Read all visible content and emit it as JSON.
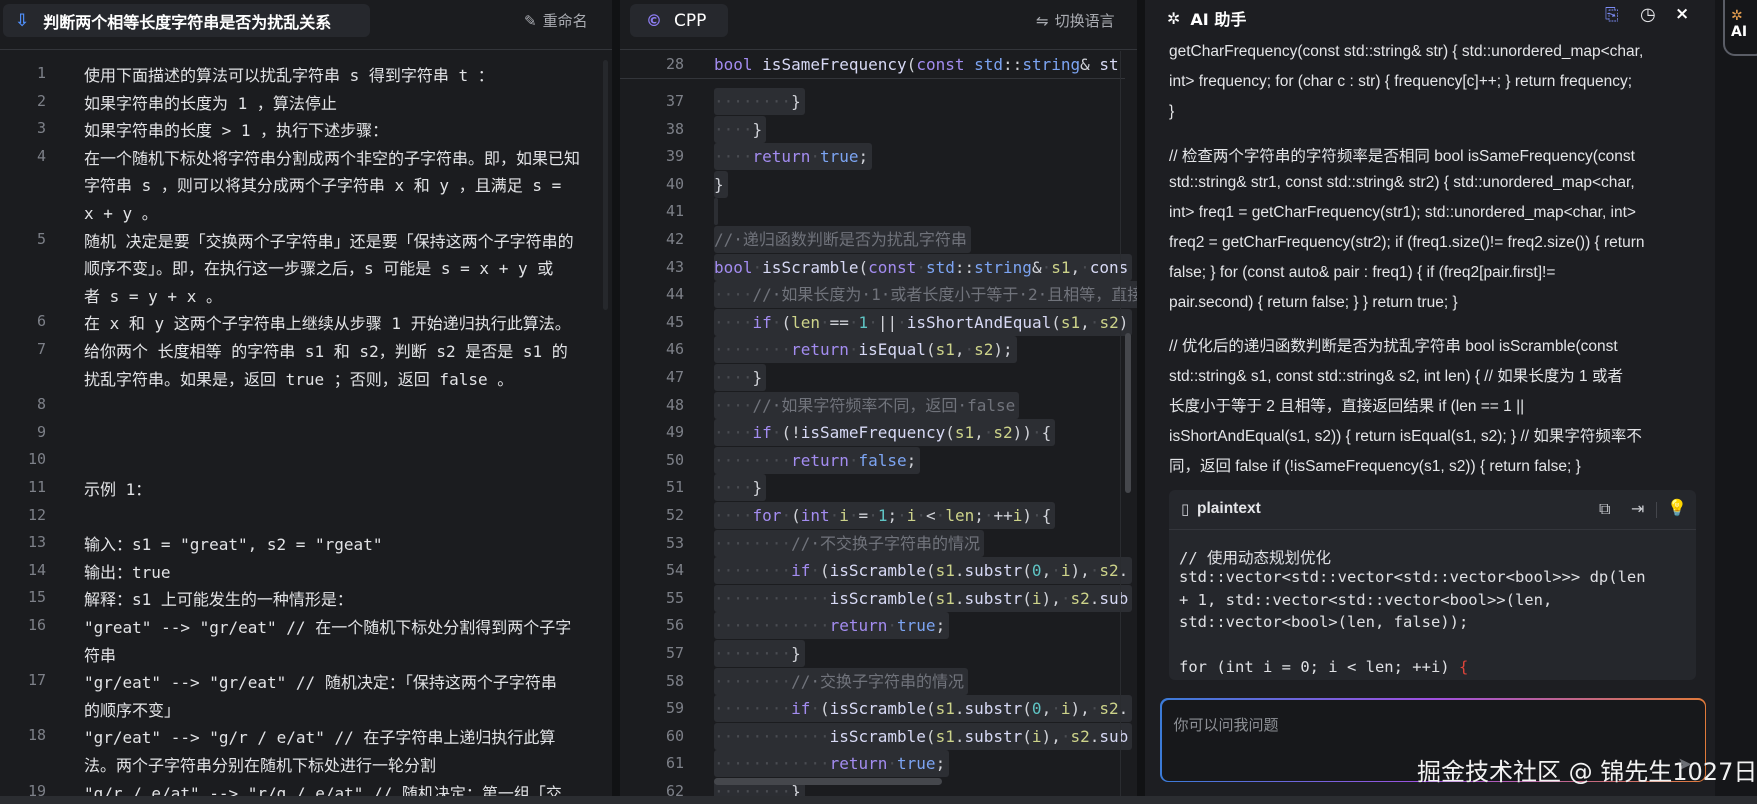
{
  "left": {
    "title": "判断两个相等长度字符串是否为扰乱关系",
    "rename_label": "重命名",
    "lines": [
      {
        "n": "1",
        "rows": [
          "使用下面描述的算法可以扰乱字符串 s 得到字符串 t ："
        ]
      },
      {
        "n": "2",
        "rows": [
          "如果字符串的长度为 1 ，算法停止"
        ]
      },
      {
        "n": "3",
        "rows": [
          "如果字符串的长度 > 1 ，执行下述步骤："
        ]
      },
      {
        "n": "4",
        "rows": [
          "在一个随机下标处将字符串分割成两个非空的子字符串。即，如果已知",
          "字符串 s ，则可以将其分成两个子字符串 x 和 y ，且满足 s =",
          "x + y 。"
        ]
      },
      {
        "n": "5",
        "rows": [
          "随机 决定是要「交换两个子字符串」还是要「保持这两个子字符串的",
          "顺序不变」。即，在执行这一步骤之后，s 可能是 s = x + y 或",
          "者 s = y + x 。"
        ]
      },
      {
        "n": "6",
        "rows": [
          "在 x 和 y 这两个子字符串上继续从步骤 1 开始递归执行此算法。"
        ]
      },
      {
        "n": "7",
        "rows": [
          "给你两个 长度相等 的字符串 s1 和 s2，判断 s2 是否是 s1 的",
          "扰乱字符串。如果是，返回 true ；否则，返回 false 。"
        ]
      },
      {
        "n": "8",
        "rows": [
          ""
        ]
      },
      {
        "n": "9",
        "rows": [
          ""
        ]
      },
      {
        "n": "10",
        "rows": [
          ""
        ]
      },
      {
        "n": "11",
        "rows": [
          "示例 1："
        ]
      },
      {
        "n": "12",
        "rows": [
          ""
        ]
      },
      {
        "n": "13",
        "rows": [
          "输入：s1 = \"great\", s2 = \"rgeat\""
        ]
      },
      {
        "n": "14",
        "rows": [
          "输出：true"
        ]
      },
      {
        "n": "15",
        "rows": [
          "解释：s1 上可能发生的一种情形是："
        ]
      },
      {
        "n": "16",
        "rows": [
          "\"great\" --> \"gr/eat\" // 在一个随机下标处分割得到两个子字",
          "符串"
        ]
      },
      {
        "n": "17",
        "rows": [
          "\"gr/eat\" --> \"gr/eat\" // 随机决定：「保持这两个子字符串",
          "的顺序不变」"
        ]
      },
      {
        "n": "18",
        "rows": [
          "\"gr/eat\" --> \"g/r / e/at\" // 在子字符串上递归执行此算",
          "法。两个子字符串分别在随机下标处进行一轮分割"
        ]
      },
      {
        "n": "19",
        "rows": [
          "\"g/r / e/at\" --> \"r/g / e/at\" // 随机决定：第一组「交"
        ]
      }
    ]
  },
  "editor": {
    "language": "CPP",
    "switch_language_label": "切换语言",
    "sticky": {
      "n": "28",
      "code": "bool isSameFrequency(const std::string& st"
    },
    "lines": [
      {
        "n": "37",
        "code": "········}"
      },
      {
        "n": "38",
        "code": "····}"
      },
      {
        "n": "39",
        "code": "····return·true;"
      },
      {
        "n": "40",
        "code": "}"
      },
      {
        "n": "41",
        "code": ""
      },
      {
        "n": "42",
        "code": "//·递归函数判断是否为扰乱字符串"
      },
      {
        "n": "43",
        "code": "bool·isScramble(const·std::string&·s1,·cons"
      },
      {
        "n": "44",
        "code": "····//·如果长度为·1·或者长度小于等于·2·且相等，直接"
      },
      {
        "n": "45",
        "code": "····if·(len·==·1·||·isShortAndEqual(s1,·s2)"
      },
      {
        "n": "46",
        "code": "········return·isEqual(s1,·s2);"
      },
      {
        "n": "47",
        "code": "····}"
      },
      {
        "n": "48",
        "code": "····//·如果字符频率不同，返回·false"
      },
      {
        "n": "49",
        "code": "····if·(!isSameFrequency(s1,·s2))·{"
      },
      {
        "n": "50",
        "code": "········return·false;"
      },
      {
        "n": "51",
        "code": "····}"
      },
      {
        "n": "52",
        "code": "····for·(int·i·=·1;·i·<·len;·++i)·{"
      },
      {
        "n": "53",
        "code": "········//·不交换子字符串的情况"
      },
      {
        "n": "54",
        "code": "········if·(isScramble(s1.substr(0,·i),·s2."
      },
      {
        "n": "55",
        "code": "············isScramble(s1.substr(i),·s2.sub"
      },
      {
        "n": "56",
        "code": "············return·true;"
      },
      {
        "n": "57",
        "code": "········}"
      },
      {
        "n": "58",
        "code": "········//·交换子字符串的情况"
      },
      {
        "n": "59",
        "code": "········if·(isScramble(s1.substr(0,·i),·s2."
      },
      {
        "n": "60",
        "code": "············isScramble(s1.substr(i),·s2.sub"
      },
      {
        "n": "61",
        "code": "············return·true;"
      },
      {
        "n": "62",
        "code": "········}"
      }
    ]
  },
  "assistant": {
    "title": "AI 助手",
    "paragraphs": [
      [
        "getCharFrequency(const std::string& str) { std::unordered_map<char,",
        "int> frequency; for (char c : str) { frequency[c]++; } return frequency;",
        "}"
      ],
      [
        "// 检查两个字符串的字符频率是否相同 bool isSameFrequency(const",
        "std::string& str1, const std::string& str2) { std::unordered_map<char,",
        "int> freq1 = getCharFrequency(str1); std::unordered_map<char, int>",
        "freq2 = getCharFrequency(str2); if (freq1.size()!= freq2.size()) { return",
        "false; } for (const auto& pair : freq1) { if (freq2[pair.first]!=",
        "pair.second) { return false; } } return true; }"
      ],
      [
        "// 优化后的递归函数判断是否为扰乱字符串 bool isScramble(const",
        "std::string& s1, const std::string& s2, int len) { // 如果长度为 1 或者",
        "长度小于等于 2 且相等，直接返回结果 if (len == 1 ||",
        "isShortAndEqual(s1, s2)) { return isEqual(s1, s2); } // 如果字符频率不",
        "同，返回 false if (!isSameFrequency(s1, s2)) { return false; }"
      ]
    ],
    "code_block": {
      "language": "plaintext",
      "lines": [
        "// 使用动态规划优化",
        "std::vector<std::vector<std::vector<bool>>> dp(len",
        "+ 1, std::vector<std::vector<bool>>(len,",
        "std::vector<bool>(len, false));",
        "",
        "for (int i = 0; i < len; ++i) {"
      ]
    },
    "input_placeholder": "你可以问我问题",
    "watermark": "掘金技术社区 @ 锦先生1027日"
  },
  "strip": {
    "badge_label": "AI"
  },
  "colors": {
    "background": "#1b1c1f",
    "keyword": "#a38cf0",
    "type": "#7ca4f2",
    "comment": "#70737b",
    "accent": "#4f8ef7",
    "input_gradient": [
      "#3b7bd8",
      "#a050e0",
      "#e07a3a"
    ]
  }
}
